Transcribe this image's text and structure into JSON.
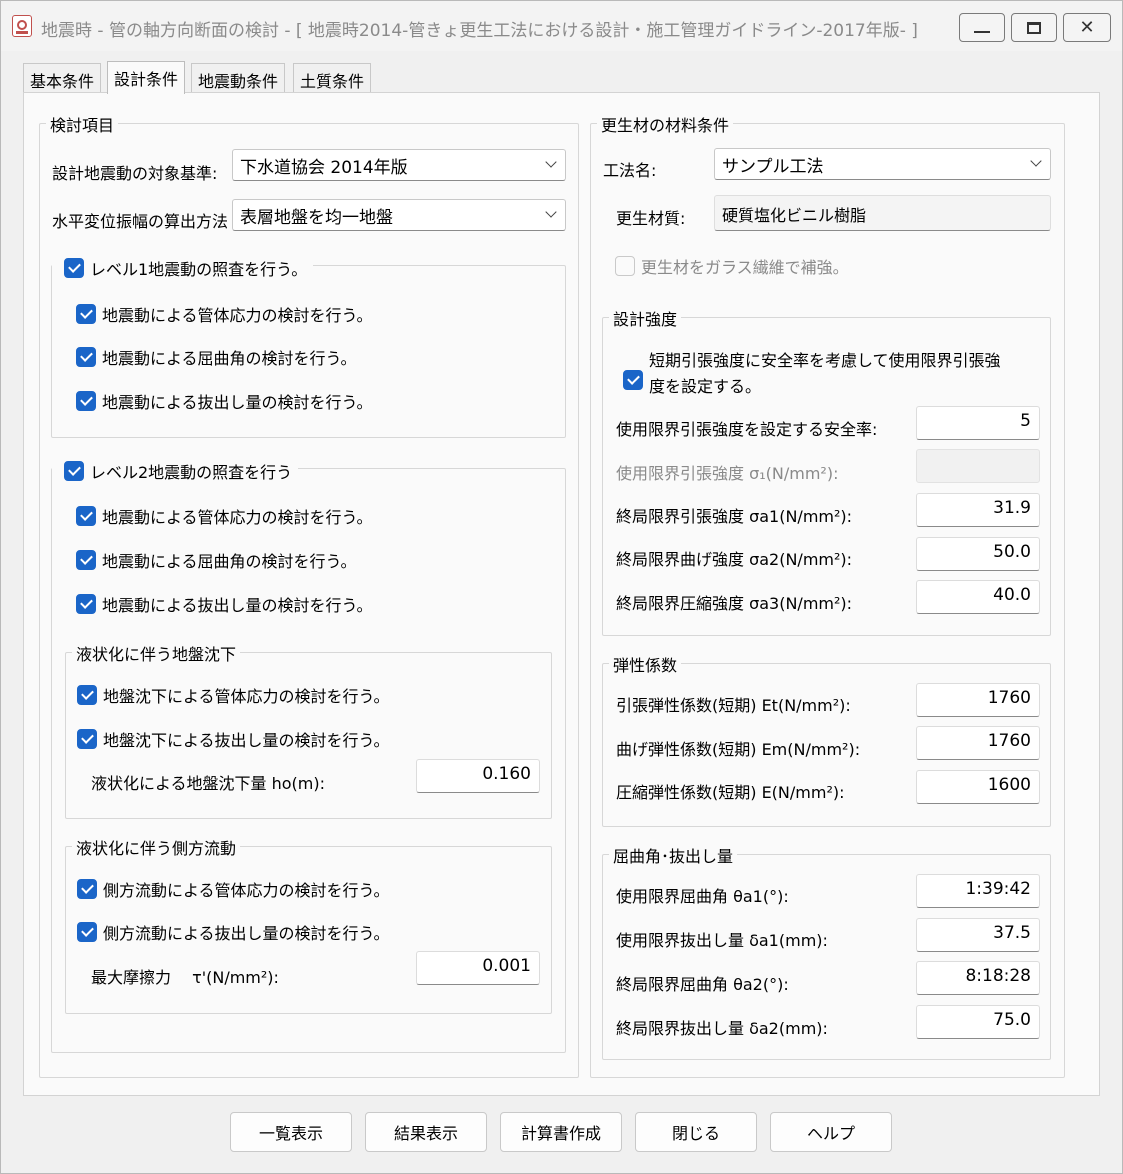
{
  "window": {
    "title": "地震時 - 管の軸方向断面の検討 - [ 地震時2014-管きょ更生工法における設計・施工管理ガイドライン-2017年版- ]",
    "controls": {
      "minimize": "",
      "maximize": "",
      "close": "✕"
    }
  },
  "tabs": [
    {
      "label": "基本条件"
    },
    {
      "label": "設計条件"
    },
    {
      "label": "地震動条件"
    },
    {
      "label": "土質条件"
    }
  ],
  "active_tab": "設計条件",
  "left": {
    "group_title": "検討項目",
    "standard": {
      "label": "設計地震動の対象基準:",
      "value": "下水道協会 2014年版"
    },
    "method": {
      "label": "水平変位振幅の算出方法",
      "value": "表層地盤を均一地盤"
    },
    "level1": {
      "label": "レベル1地震動の照査を行う。",
      "checked": true,
      "items": [
        {
          "label": "地震動による管体応力の検討を行う。",
          "checked": true
        },
        {
          "label": "地震動による屈曲角の検討を行う。",
          "checked": true
        },
        {
          "label": "地震動による抜出し量の検討を行う。",
          "checked": true
        }
      ]
    },
    "level2": {
      "label": "レベル2地震動の照査を行う",
      "checked": true,
      "items": [
        {
          "label": "地震動による管体応力の検討を行う。",
          "checked": true
        },
        {
          "label": "地震動による屈曲角の検討を行う。",
          "checked": true
        },
        {
          "label": "地震動による抜出し量の検討を行う。",
          "checked": true
        }
      ],
      "settlement": {
        "title": "液状化に伴う地盤沈下",
        "items": [
          {
            "label": "地盤沈下による管体応力の検討を行う。",
            "checked": true
          },
          {
            "label": "地盤沈下による抜出し量の検討を行う。",
            "checked": true
          }
        ],
        "field_label": "液状化による地盤沈下量 ho(m):",
        "field_value": "0.160"
      },
      "lateral": {
        "title": "液状化に伴う側方流動",
        "items": [
          {
            "label": "側方流動による管体応力の検討を行う。",
            "checked": true
          },
          {
            "label": "側方流動による抜出し量の検討を行う。",
            "checked": true
          }
        ],
        "field_label": "最大摩擦力　 τ'(N/mm²):",
        "field_value": "0.001"
      }
    }
  },
  "right": {
    "group_title": "更生材の材料条件",
    "method": {
      "label": "工法名:",
      "value": "サンプル工法"
    },
    "material": {
      "label": "更生材質:",
      "value": "硬質塩化ビニル樹脂"
    },
    "glass_fiber": {
      "label": "更生材をガラス繊維で補強。",
      "checked": false
    },
    "strength": {
      "title": "設計強度",
      "safety_check": {
        "label_line1": "短期引張強度に安全率を考慮して使用限界引張強",
        "label_line2": "度を設定する。",
        "checked": true
      },
      "rows": [
        {
          "label": "使用限界引張強度を設定する安全率:",
          "value": "5"
        },
        {
          "label": "使用限界引張強度 σ₁(N/mm²):",
          "value": ""
        },
        {
          "label": "終局限界引張強度 σa1(N/mm²):",
          "value": "31.9"
        },
        {
          "label": "終局限界曲げ強度 σa2(N/mm²):",
          "value": "50.0"
        },
        {
          "label": "終局限界圧縮強度 σa3(N/mm²):",
          "value": "40.0"
        }
      ]
    },
    "elastic": {
      "title": "弾性係数",
      "rows": [
        {
          "label": "引張弾性係数(短期) Et(N/mm²):",
          "value": "1760"
        },
        {
          "label": "曲げ弾性係数(短期) Em(N/mm²):",
          "value": "1760"
        },
        {
          "label": "圧縮弾性係数(短期) E(N/mm²):",
          "value": "1600"
        }
      ]
    },
    "bending": {
      "title": "屈曲角･抜出し量",
      "rows": [
        {
          "label": "使用限界屈曲角 θa1(°):",
          "value": "1:39:42"
        },
        {
          "label": "使用限界抜出し量 δa1(mm):",
          "value": "37.5"
        },
        {
          "label": "終局限界屈曲角 θa2(°):",
          "value": "8:18:28"
        },
        {
          "label": "終局限界抜出し量 δa2(mm):",
          "value": "75.0"
        }
      ]
    }
  },
  "buttons": {
    "list": "一覧表示",
    "result": "結果表示",
    "report": "計算書作成",
    "close": "閉じる",
    "help": "ヘルプ"
  }
}
